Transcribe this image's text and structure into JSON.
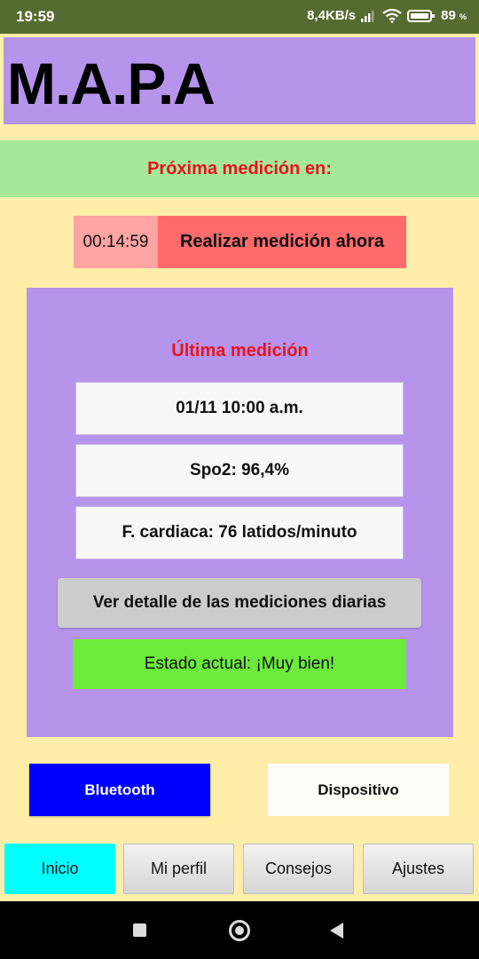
{
  "status_bar": {
    "time": "19:59",
    "network_speed": "8,4KB/s",
    "battery_percent": "89",
    "battery_unit": "%",
    "icons": [
      "signal-icon",
      "wifi-icon",
      "battery-icon"
    ]
  },
  "header": {
    "title": "M.A.P.A"
  },
  "next_measurement": {
    "label": "Próxima medición en:",
    "timer": "00:14:59",
    "action_label": "Realizar medición ahora"
  },
  "last_measurement": {
    "title": "Última medición",
    "datetime": "01/11 10:00 a.m.",
    "spo2": "Spo2: 96,4%",
    "heart_rate": "F. cardiaca: 76 latidos/minuto",
    "details_label": "Ver detalle de las mediciones diarias",
    "status": "Estado actual: ¡Muy bien!"
  },
  "device_buttons": {
    "bluetooth": "Bluetooth",
    "device": "Dispositivo"
  },
  "bottom_nav": {
    "items": [
      {
        "label": "Inicio",
        "active": true
      },
      {
        "label": "Mi perfil",
        "active": false
      },
      {
        "label": "Consejos",
        "active": false
      },
      {
        "label": "Ajustes",
        "active": false
      }
    ]
  },
  "colors": {
    "background": "#FFEEAA",
    "header": "#B794EC",
    "banner": "#A5E89A",
    "accent_red": "#E8141C",
    "timer_bg": "#FFA3A3",
    "action_bg": "#FF6B6B",
    "status_ok": "#6DEB3D",
    "bluetooth": "#0000FF",
    "nav_active": "#00FFFF"
  }
}
